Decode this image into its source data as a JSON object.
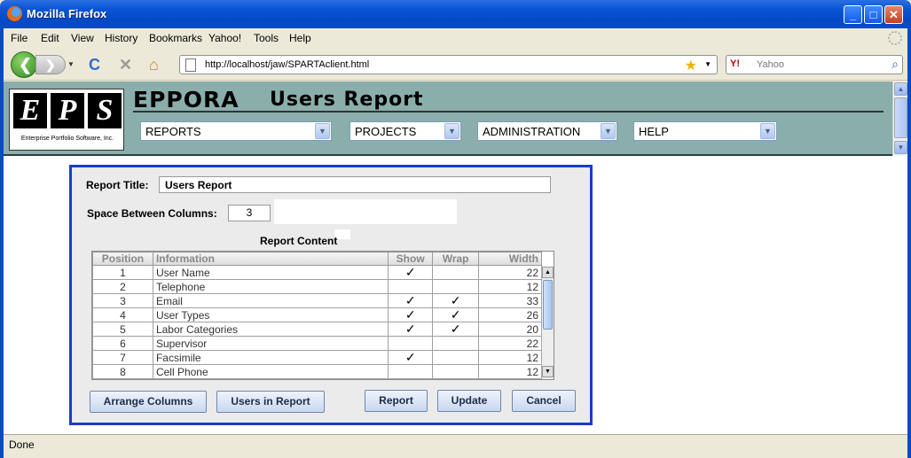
{
  "window": {
    "title": "Mozilla Firefox",
    "minimize": "_",
    "maximize": "□",
    "close": "✕"
  },
  "menu": [
    "File",
    "Edit",
    "View",
    "History",
    "Bookmarks",
    "Yahoo!",
    "Tools",
    "Help"
  ],
  "nav": {
    "url": "http://localhost/jaw/SPARTAclient.html",
    "search_engine": "Y!",
    "search_placeholder": "Yahoo",
    "icons": [
      "back-icon",
      "forward-icon",
      "reload-icon",
      "stop-icon",
      "home-icon",
      "bookmark-star-icon",
      "search-icon"
    ]
  },
  "header": {
    "logo_letters": [
      "E",
      "P",
      "S"
    ],
    "logo_subtitle": "Enterprise Portfolio Software, Inc.",
    "app_name": "EPPORA",
    "page_title": "Users Report",
    "menus": [
      "REPORTS",
      "PROJECTS",
      "ADMINISTRATION",
      "HELP"
    ]
  },
  "report": {
    "title_label": "Report Title:",
    "title_value": "Users Report",
    "space_label": "Space Between Columns:",
    "space_value": "3",
    "content_label": "Report Content",
    "columns": [
      "Position",
      "Information",
      "Show",
      "Wrap",
      "Width"
    ],
    "rows": [
      {
        "position": "1",
        "information": "User Name",
        "show": true,
        "wrap": false,
        "width": "22"
      },
      {
        "position": "2",
        "information": "Telephone",
        "show": false,
        "wrap": false,
        "width": "12"
      },
      {
        "position": "3",
        "information": "Email",
        "show": true,
        "wrap": true,
        "width": "33"
      },
      {
        "position": "4",
        "information": "User Types",
        "show": true,
        "wrap": true,
        "width": "26"
      },
      {
        "position": "5",
        "information": "Labor Categories",
        "show": true,
        "wrap": true,
        "width": "20"
      },
      {
        "position": "6",
        "information": "Supervisor",
        "show": false,
        "wrap": false,
        "width": "22"
      },
      {
        "position": "7",
        "information": "Facsimile",
        "show": true,
        "wrap": false,
        "width": "12"
      },
      {
        "position": "8",
        "information": "Cell Phone",
        "show": false,
        "wrap": false,
        "width": "12"
      }
    ],
    "buttons": {
      "arrange": "Arrange Columns",
      "users": "Users in Report",
      "report": "Report",
      "update": "Update",
      "cancel": "Cancel"
    }
  },
  "status": "Done",
  "colors": {
    "header_bg": "#8aaeac",
    "panel_border": "#1a3bcc",
    "titlebar": "#0a56d8"
  }
}
